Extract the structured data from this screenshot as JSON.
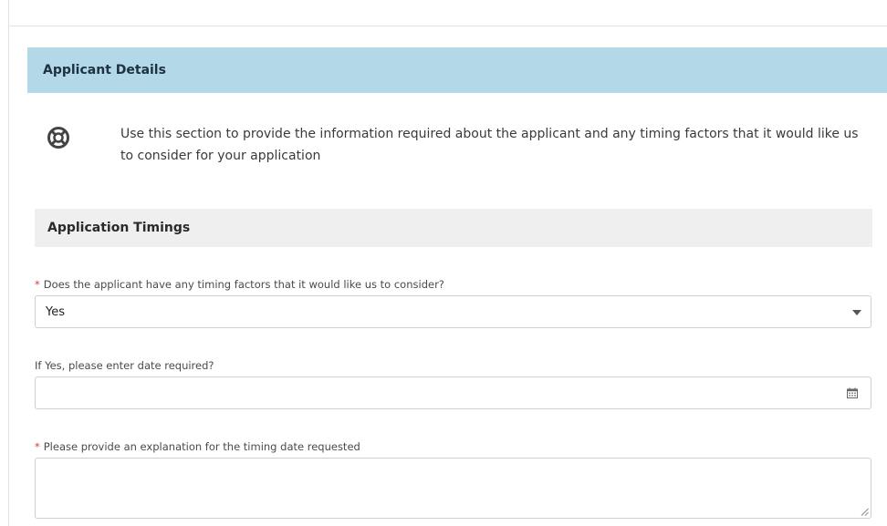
{
  "section": {
    "title": "Applicant Details",
    "help_text": "Use this section to provide the information required about the applicant and any timing factors that it would like us to consider for your application",
    "help_icon": "lifebuoy-icon"
  },
  "subsection": {
    "title": "Application Timings"
  },
  "fields": {
    "timing_factors": {
      "label": "Does the applicant have any timing factors that it would like us to consider?",
      "required_marker": "*",
      "value": "Yes",
      "icon": "chevron-down-icon"
    },
    "date_required": {
      "label": "If Yes, please enter date required?",
      "value": "",
      "icon": "calendar-icon"
    },
    "explanation": {
      "label": "Please provide an explanation for the timing date requested",
      "required_marker": "*",
      "value": ""
    }
  },
  "colors": {
    "section_header_bg": "#b3d8e8",
    "subsection_bg": "#efefef",
    "required": "#d04040"
  }
}
